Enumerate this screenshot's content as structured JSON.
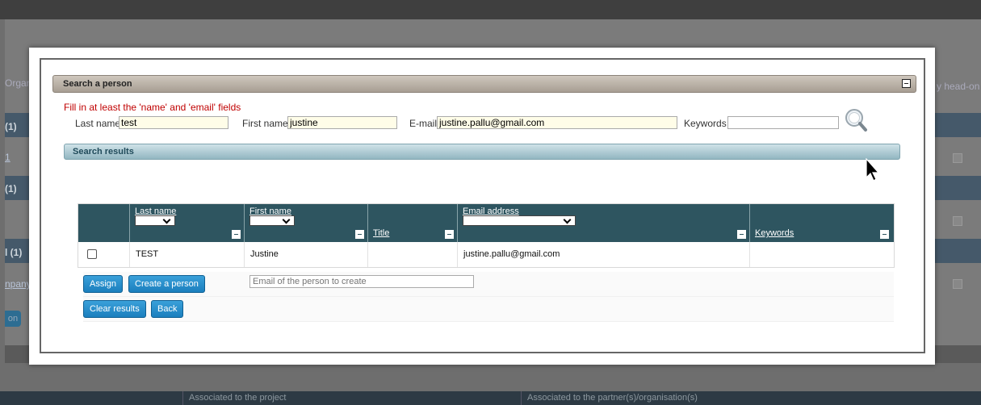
{
  "background": {
    "left_labels": [
      "Organ",
      "(1)",
      "1",
      "(1)",
      "l (1)",
      "npany",
      "on"
    ],
    "right_label": "y head-on",
    "footer": [
      "Associated to the project",
      "Associated to the partner(s)/organisation(s)"
    ]
  },
  "search_section": {
    "title": "Search a person",
    "hint": "Fill in at least the 'name' and 'email' fields",
    "fields": {
      "last_name": {
        "label": "Last name",
        "value": "test"
      },
      "first_name": {
        "label": "First name",
        "value": "justine"
      },
      "email": {
        "label": "E-mail",
        "value": "justine.pallu@gmail.com"
      },
      "keywords": {
        "label": "Keywords",
        "value": ""
      }
    }
  },
  "results_section": {
    "title": "Search results",
    "columns": [
      "Last name",
      "First name",
      "Title",
      "Email address",
      "Keywords"
    ],
    "rows": [
      {
        "last_name": "TEST",
        "first_name": "Justine",
        "title": "",
        "email": "justine.pallu@gmail.com",
        "keywords": ""
      }
    ]
  },
  "actions": {
    "assign": "Assign",
    "create_person": "Create a person",
    "create_placeholder": "Email of the person to create",
    "clear_results": "Clear results",
    "back": "Back"
  },
  "colors": {
    "accent": "#1b7fbe",
    "table_header": "#2e5560",
    "hint": "#c00000"
  }
}
